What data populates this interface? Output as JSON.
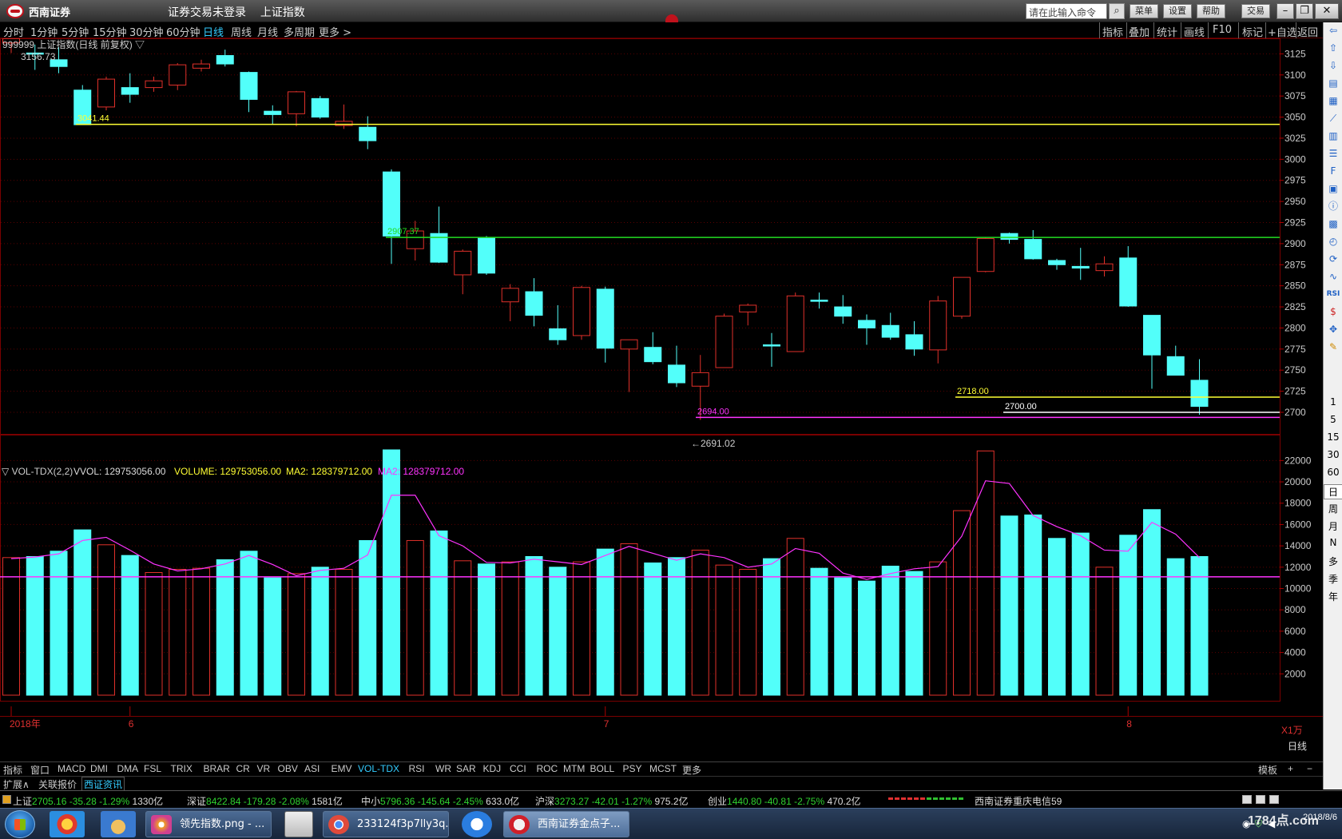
{
  "app": {
    "logo_text": "西南证券",
    "title_login": "证券交易未登录",
    "title_index": "上证指数",
    "search_placeholder": "请在此输入命令",
    "buttons": [
      "菜单",
      "设置",
      "帮助",
      "交易"
    ]
  },
  "periods": [
    "分时",
    "1分钟",
    "5分钟",
    "15分钟",
    "30分钟",
    "60分钟",
    "日线",
    "周线",
    "月线",
    "多周期",
    "更多 >"
  ],
  "active_period": "日线",
  "right_tools": [
    "指标",
    "叠加",
    "统计",
    "画线",
    "F10",
    "标记",
    "+自选",
    "返回"
  ],
  "sidebar_labels": [
    "1",
    "5",
    "15",
    "30",
    "60",
    "日",
    "周",
    "月",
    "N",
    "多",
    "季",
    "年"
  ],
  "chart_header": "999999 上证指数(日线 前复权) ▽",
  "colors": {
    "up": "#e0302a",
    "down": "#52fffa",
    "grid": "#5a0000",
    "ma": "#ff33ff",
    "yellow": "#ffff33",
    "green": "#22dd22"
  },
  "chart_data": {
    "type": "candlestick",
    "price_axis": {
      "ticks": [
        2700,
        2725,
        2750,
        2775,
        2800,
        2825,
        2850,
        2875,
        2900,
        2925,
        2950,
        2975,
        3000,
        3025,
        3050,
        3075,
        3100,
        3125,
        3150
      ]
    },
    "candles": [
      {
        "o": 3138,
        "c": 3143,
        "h": 3158,
        "l": 3126
      },
      {
        "o": 3126,
        "c": 3126,
        "h": 3136,
        "l": 3106
      },
      {
        "o": 3118,
        "c": 3110,
        "h": 3133,
        "l": 3102
      },
      {
        "o": 3082,
        "c": 3041,
        "h": 3088,
        "l": 3041
      },
      {
        "o": 3062,
        "c": 3095,
        "h": 3098,
        "l": 3058
      },
      {
        "o": 3085,
        "c": 3077,
        "h": 3102,
        "l": 3067
      },
      {
        "o": 3085,
        "c": 3093,
        "h": 3098,
        "l": 3080
      },
      {
        "o": 3088,
        "c": 3112,
        "h": 3114,
        "l": 3082
      },
      {
        "o": 3108,
        "c": 3113,
        "h": 3118,
        "l": 3104
      },
      {
        "o": 3123,
        "c": 3113,
        "h": 3130,
        "l": 3110
      },
      {
        "o": 3103,
        "c": 3071,
        "h": 3104,
        "l": 3056
      },
      {
        "o": 3057,
        "c": 3053,
        "h": 3064,
        "l": 3041
      },
      {
        "o": 3054,
        "c": 3080,
        "h": 3081,
        "l": 3039
      },
      {
        "o": 3072,
        "c": 3050,
        "h": 3075,
        "l": 3048
      },
      {
        "o": 3040,
        "c": 3045,
        "h": 3065,
        "l": 3036
      },
      {
        "o": 3038,
        "c": 3022,
        "h": 3051,
        "l": 3012
      },
      {
        "o": 2985,
        "c": 2909,
        "h": 2988,
        "l": 2876
      },
      {
        "o": 2894,
        "c": 2915,
        "h": 2927,
        "l": 2880
      },
      {
        "o": 2912,
        "c": 2878,
        "h": 2944,
        "l": 2877
      },
      {
        "o": 2863,
        "c": 2891,
        "h": 2893,
        "l": 2840
      },
      {
        "o": 2907,
        "c": 2865,
        "h": 2909,
        "l": 2863
      },
      {
        "o": 2831,
        "c": 2847,
        "h": 2852,
        "l": 2808
      },
      {
        "o": 2843,
        "c": 2815,
        "h": 2859,
        "l": 2802
      },
      {
        "o": 2799,
        "c": 2786,
        "h": 2827,
        "l": 2780
      },
      {
        "o": 2791,
        "c": 2848,
        "h": 2850,
        "l": 2786
      },
      {
        "o": 2846,
        "c": 2776,
        "h": 2849,
        "l": 2759
      },
      {
        "o": 2775,
        "c": 2786,
        "h": 2786,
        "l": 2724
      },
      {
        "o": 2777,
        "c": 2760,
        "h": 2795,
        "l": 2757
      },
      {
        "o": 2756,
        "c": 2735,
        "h": 2779,
        "l": 2730
      },
      {
        "o": 2731,
        "c": 2747,
        "h": 2768,
        "l": 2691.02
      },
      {
        "o": 2753,
        "c": 2814,
        "h": 2817,
        "l": 2753
      },
      {
        "o": 2819,
        "c": 2827,
        "h": 2829,
        "l": 2803
      },
      {
        "o": 2780,
        "c": 2779,
        "h": 2794,
        "l": 2754
      },
      {
        "o": 2772,
        "c": 2838,
        "h": 2842,
        "l": 2772
      },
      {
        "o": 2833,
        "c": 2833,
        "h": 2842,
        "l": 2823
      },
      {
        "o": 2825,
        "c": 2814,
        "h": 2839,
        "l": 2805
      },
      {
        "o": 2809,
        "c": 2800,
        "h": 2816,
        "l": 2780
      },
      {
        "o": 2803,
        "c": 2789,
        "h": 2818,
        "l": 2786
      },
      {
        "o": 2792,
        "c": 2775,
        "h": 2808,
        "l": 2767
      },
      {
        "o": 2774,
        "c": 2832,
        "h": 2838,
        "l": 2758
      },
      {
        "o": 2814,
        "c": 2860,
        "h": 2860,
        "l": 2811
      },
      {
        "o": 2867,
        "c": 2906,
        "h": 2907,
        "l": 2866
      },
      {
        "o": 2912,
        "c": 2905,
        "h": 2913,
        "l": 2900
      },
      {
        "o": 2905,
        "c": 2882,
        "h": 2916,
        "l": 2881
      },
      {
        "o": 2880,
        "c": 2875,
        "h": 2882,
        "l": 2869
      },
      {
        "o": 2873,
        "c": 2871,
        "h": 2895,
        "l": 2857
      },
      {
        "o": 2868,
        "c": 2876,
        "h": 2885,
        "l": 2861
      },
      {
        "o": 2883,
        "c": 2826,
        "h": 2897,
        "l": 2825
      },
      {
        "o": 2815,
        "c": 2768,
        "h": 2815,
        "l": 2728
      },
      {
        "o": 2766,
        "c": 2744,
        "h": 2779,
        "l": 2744
      },
      {
        "o": 2738,
        "c": 2707,
        "h": 2763,
        "l": 2697
      }
    ],
    "marker_high_label": "3156.73",
    "marker_low_label": "←2691.02",
    "hlines": [
      {
        "value": 3041.44,
        "label": "3041.44",
        "color": "#ffff33"
      },
      {
        "value": 2907.37,
        "label": "2907.37",
        "color": "#22dd22"
      },
      {
        "value": 2718.0,
        "label": "2718.00",
        "color": "#ffff33"
      },
      {
        "value": 2700.0,
        "label": "2700.00",
        "color": "#ffffff"
      },
      {
        "value": 2694.0,
        "label": "2694.00",
        "color": "#ff33ff"
      }
    ],
    "volume": {
      "header": {
        "name": "▽ VOL-TDX(2,2)",
        "vvol": "VVOL: 129753056.00",
        "volume": "VOLUME: 129753056.00",
        "ma2": "MA2: 128379712.00",
        "ma2b": "MA2: 128379712.00"
      },
      "ticks": [
        2000,
        4000,
        6000,
        8000,
        10000,
        12000,
        14000,
        16000,
        18000,
        20000,
        22000
      ],
      "unit_label": "X1万",
      "values": [
        12900,
        13000,
        13500,
        15500,
        14100,
        13100,
        11500,
        11800,
        11900,
        12700,
        13500,
        11000,
        11400,
        12000,
        11800,
        14500,
        23000,
        14500,
        15400,
        12600,
        12300,
        12500,
        13000,
        12000,
        12500,
        13700,
        14200,
        12400,
        12900,
        13600,
        12200,
        11800,
        12800,
        14700,
        11900,
        11000,
        10700,
        12100,
        11600,
        12500,
        17300,
        22900,
        16800,
        16900,
        14700,
        15200,
        12000,
        15000,
        17400,
        12800,
        13000
      ],
      "ma": [
        12800,
        12950,
        13250,
        14500,
        14800,
        13600,
        12300,
        11650,
        11850,
        12300,
        13100,
        12250,
        11200,
        11700,
        11900,
        13150,
        18750,
        18750,
        14950,
        14000,
        12450,
        12400,
        12750,
        12500,
        12250,
        13100,
        13950,
        13300,
        12650,
        13250,
        12900,
        12000,
        12300,
        13750,
        13300,
        11450,
        10850,
        11400,
        11850,
        12050,
        14900,
        20100,
        19850,
        16850,
        15800,
        14950,
        13600,
        13500,
        16200,
        15100,
        12900
      ],
      "baseline": 11100
    },
    "x_labels": [
      {
        "index": 0,
        "text": "2018年"
      },
      {
        "index": 5,
        "text": "6"
      },
      {
        "index": 25,
        "text": "7"
      },
      {
        "index": 47,
        "text": "8"
      }
    ],
    "x_axis_right": "日线"
  },
  "indicator_tabs": [
    "指标",
    "窗口",
    "MACD",
    "DMI",
    "DMA",
    "FSL",
    "TRIX",
    "BRAR",
    "CR",
    "VR",
    "OBV",
    "ASI",
    "EMV",
    "VOL-TDX",
    "RSI",
    "WR",
    "SAR",
    "KDJ",
    "CCI",
    "ROC",
    "MTM",
    "BOLL",
    "PSY",
    "MCST",
    "更多"
  ],
  "active_indicator": "VOL-TDX",
  "indicator_right": [
    "模板",
    "+",
    "−"
  ],
  "sub_tabs": [
    "扩展∧",
    "关联报价",
    "西证资讯"
  ],
  "status": [
    {
      "name": "上证",
      "value": "2705.16",
      "chg": "-35.28",
      "pct": "-1.29%",
      "amt": "1330亿"
    },
    {
      "name": "深证",
      "value": "8422.84",
      "chg": "-179.28",
      "pct": "-2.08%",
      "amt": "1581亿"
    },
    {
      "name": "中小",
      "value": "5796.36",
      "chg": "-145.64",
      "pct": "-2.45%",
      "amt": "633.0亿"
    },
    {
      "name": "沪深",
      "value": "3273.27",
      "chg": "-42.01",
      "pct": "-1.27%",
      "amt": "975.2亿"
    },
    {
      "name": "创业",
      "value": "1440.80",
      "chg": "-40.81",
      "pct": "-2.75%",
      "amt": "470.2亿"
    }
  ],
  "status_server": "西南证券重庆电信59",
  "taskbar": {
    "tasks": [
      "领先指数.png - ...",
      "233124f3p7lly3q...",
      "西南证券金点子..."
    ],
    "clock_date": "2018/8/6",
    "watermark": "1784点.com"
  }
}
